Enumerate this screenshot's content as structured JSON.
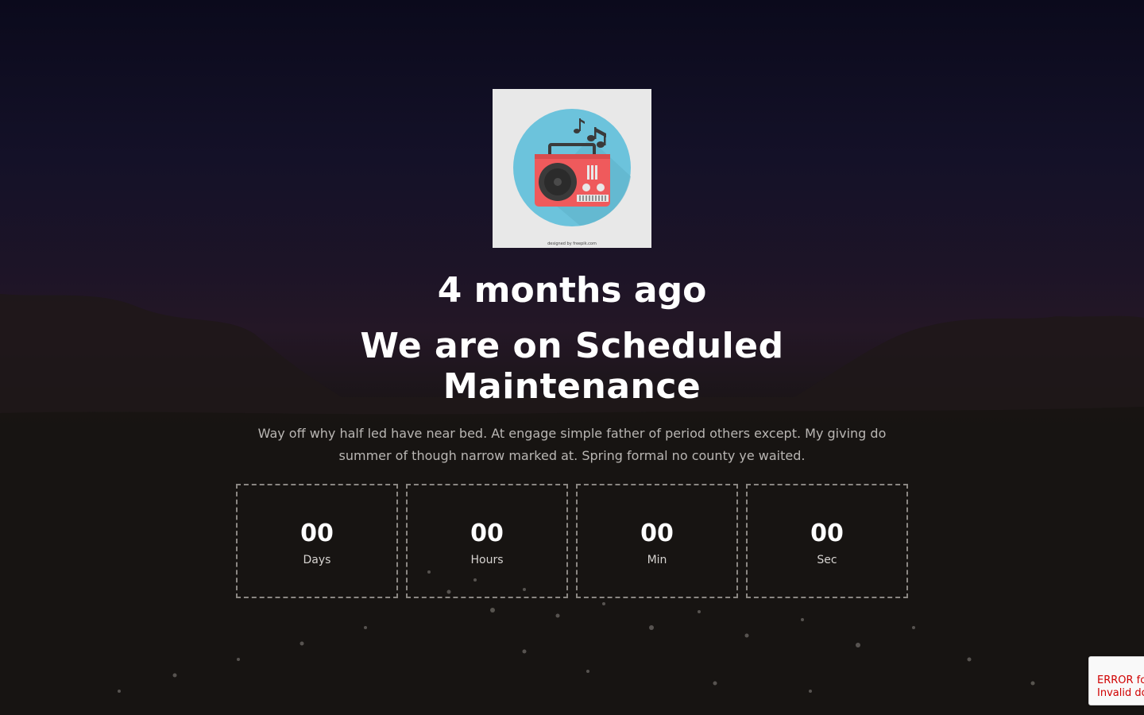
{
  "logo": {
    "icon": "radio-logo-icon",
    "credit": "designed by freepik.com",
    "colors": {
      "circle": "#6cc3dc",
      "radio": "#ef5a5c",
      "panel": "#e8e8e8"
    }
  },
  "hero": {
    "time_ago": "4 months ago",
    "title": "We are on Scheduled Maintenance",
    "description": "Way off why half led have near bed. At engage simple father of period others except. My giving do summer of though narrow marked at. Spring formal no county ye waited."
  },
  "countdown": [
    {
      "value": "00",
      "label": "Days"
    },
    {
      "value": "00",
      "label": "Hours"
    },
    {
      "value": "00",
      "label": "Min"
    },
    {
      "value": "00",
      "label": "Sec"
    }
  ],
  "recaptcha": {
    "line1": "ERROR fo",
    "line2": "Invalid do"
  },
  "colors": {
    "background": "#0c0b1a",
    "text": "#ffffff",
    "muted_text": "#b9b6b3",
    "timer_border": "#8a8682",
    "error": "#d00000"
  }
}
